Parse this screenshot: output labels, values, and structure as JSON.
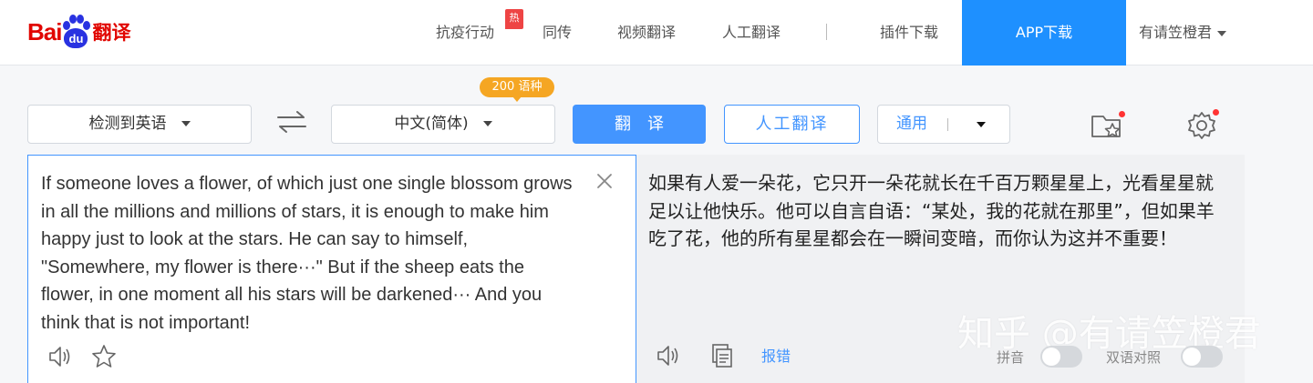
{
  "logo": {
    "bai": "Bai",
    "du": "du",
    "fanyi": "翻译"
  },
  "nav": {
    "items": [
      {
        "label": "抗疫行动"
      },
      {
        "label": "同传"
      },
      {
        "label": "视频翻译"
      },
      {
        "label": "人工翻译"
      },
      {
        "label": "插件下载"
      }
    ],
    "hot_badge": "热",
    "app_download": "APP下载",
    "user": "有请笠橙君"
  },
  "toolbar": {
    "source_lang": "检测到英语",
    "target_lang": "中文(简体)",
    "lang_count_badge": "200 语种",
    "translate_button": "翻译",
    "human_translate_button": "人工翻译",
    "domain": "通用"
  },
  "source": {
    "text": "If someone loves a flower, of which just one single blossom grows in all the millions and millions of stars, it is enough to make him happy just to look at the stars. He can say to himself, \"Somewhere, my flower is there···\" But if the sheep eats the flower, in one moment all his stars will be darkened··· And you think that is not important!"
  },
  "target": {
    "text": "如果有人爱一朵花，它只开一朵花就长在千百万颗星星上，光看星星就足以让他快乐。他可以自言自语：“某处，我的花就在那里”，但如果羊吃了花，他的所有星星都会在一瞬间变暗，而你认为这并不重要！",
    "report": "报错",
    "pinyin_label": "拼音",
    "bilingual_label": "双语对照",
    "pinyin_on": false,
    "bilingual_on": false
  },
  "watermark": "知乎 @有请笠橙君",
  "colors": {
    "accent": "#4395ff",
    "brand_red": "#e10601",
    "brand_blue": "#2932e1",
    "app_button": "#1e90ff",
    "badge": "#f5a623"
  }
}
